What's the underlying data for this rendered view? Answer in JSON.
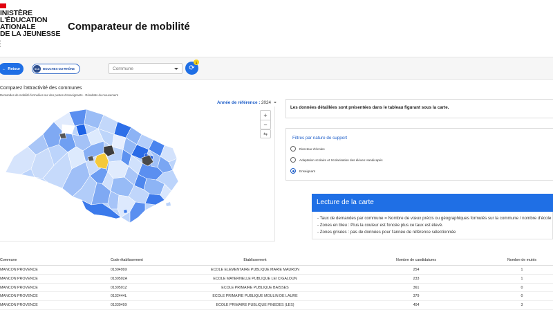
{
  "header": {
    "logo_lines": [
      "INISTÈRE",
      "L'ÉDUCATION",
      "ATIONALE",
      "DE LA JEUNESSE"
    ],
    "page_title": "Comparateur de mobilité"
  },
  "toolbar": {
    "back_label": "Retour",
    "department_code": "013",
    "department_label": "BOUCHES-DU-RHÔNE",
    "commune_placeholder": "Commune",
    "refresh_badge": "1"
  },
  "left": {
    "title": "Comparez l'attractivité des communes",
    "subtitle": "Demandes de mobilité formulées sur des postes d'enseignants - Résultats du mouvement",
    "year_label": "Année de référence :",
    "year_value": "2024",
    "zoom_in": "+",
    "zoom_out": "−"
  },
  "right": {
    "info_text": "Les données détaillées sont présentées dans le tableau figurant sous la carte.",
    "filters_title": "Filtres par nature de support",
    "filters": [
      {
        "label": "Directeur d'écoles",
        "checked": false
      },
      {
        "label": "Adaptation scolaire et Scolarisation des élèves Handicapés",
        "checked": false
      },
      {
        "label": "Enseignant",
        "checked": true
      }
    ],
    "lecture_title": "Lecture de la carte",
    "lecture_lines": [
      "- Taux de demandes par commune = Nombre de vœux précis ou géographiques formulés sur la commune / nombre d'école",
      "- Zones en bleu : Plus la couleur est foncée plus ce taux est élevé.",
      "- Zones grisées : pas de données pour l'année de référence sélectionnée"
    ]
  },
  "table": {
    "headers": [
      "Commune",
      "Code établissement",
      "Etablissement",
      "Nombre de candidatures",
      "Nombre de mutés"
    ],
    "rows": [
      [
        "MANCON PROVENCE",
        "0130499X",
        "ECOLE ELEMENTAIRE PUBLIQUE MARIE MAURON",
        "254",
        "1"
      ],
      [
        "MANCON PROVENCE",
        "0130502A",
        "ECOLE MATERNELLE PUBLIQUE LEI CIGALOUN",
        "233",
        "1"
      ],
      [
        "MANCON PROVENCE",
        "0130501Z",
        "ECOLE PRIMAIRE PUBLIQUE BAISSES",
        "361",
        "0"
      ],
      [
        "MANCON PROVENCE",
        "0132444L",
        "ECOLE PRIMAIRE PUBLIQUE MOULIN DE LAURE",
        "379",
        "0"
      ],
      [
        "MANCON PROVENCE",
        "0133949X",
        "ECOLE PRIMAIRE PUBLIQUE PINEDES (LES)",
        "404",
        "3"
      ]
    ]
  },
  "colors": {
    "accent": "#1f6fe5",
    "highlight_commune": "#f5c93a",
    "no_data": "#4a4a4a",
    "choropleth_light": "#cfe0fb",
    "choropleth_dark": "#0b4fd6"
  }
}
